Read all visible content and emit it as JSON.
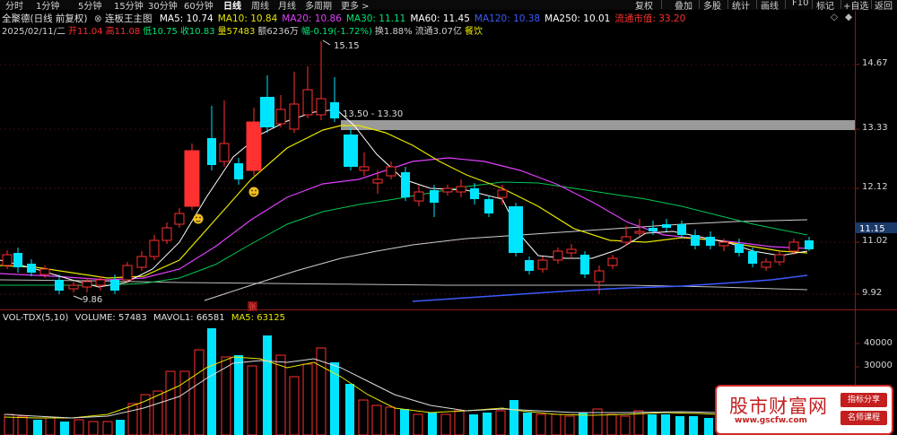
{
  "toolbar": {
    "period_tabs": [
      "分时",
      "1分钟",
      "5分钟",
      "15分钟",
      "30分钟",
      "60分钟",
      "日线",
      "周线",
      "月线",
      "多周期",
      "更多 >"
    ],
    "active_tab": "日线",
    "right_tabs": [
      "复权",
      "叠加",
      "多股",
      "统计",
      "画线",
      "F10",
      "标记",
      "+自选",
      "返回"
    ]
  },
  "title": {
    "stock": "全聚德(日线 前复权)",
    "indicator": "连板王主图",
    "ma_values": [
      {
        "label": "MA5: 10.74",
        "color": "#ffffff"
      },
      {
        "label": "MA10: 10.84",
        "color": "#e6e600"
      },
      {
        "label": "MA20: 10.86",
        "color": "#e040fb"
      },
      {
        "label": "MA30: 11.11",
        "color": "#00e676"
      },
      {
        "label": "MA60: 11.45",
        "color": "#ffffff"
      },
      {
        "label": "MA120: 10.38",
        "color": "#3d5afe"
      },
      {
        "label": "MA250: 10.01",
        "color": "#ffffff"
      },
      {
        "label": "流通市值: 33.20",
        "color": "#ff3030"
      }
    ],
    "close_icon": "diamond-icon"
  },
  "info": [
    {
      "text": "2025/02/11/二",
      "color": "#cfcfcf"
    },
    {
      "text": "开11.04",
      "color": "#ff3030"
    },
    {
      "text": "高11.08",
      "color": "#ff3030"
    },
    {
      "text": "低10.75",
      "color": "#00e676"
    },
    {
      "text": "收10.83",
      "color": "#00e676"
    },
    {
      "text": "量57483",
      "color": "#e6e600"
    },
    {
      "text": "额6236万",
      "color": "#cfcfcf"
    },
    {
      "text": "幅-0.19(-1.72%)",
      "color": "#00e676"
    },
    {
      "text": "换1.88%",
      "color": "#cfcfcf"
    },
    {
      "text": "流通3.07亿",
      "color": "#cfcfcf"
    },
    {
      "text": "餐饮",
      "color": "#e6e600"
    }
  ],
  "price_axis": {
    "ticks": [
      "14.67",
      "13.33",
      "12.12",
      "11.02",
      "9.92"
    ],
    "current_price": "11.15"
  },
  "annotations": {
    "high_label": "15.15",
    "low_label": "9.86",
    "band_label": "13.50 - 13.30",
    "limit_marker": "张"
  },
  "volume": {
    "title": "VOL-TDX(5,10)",
    "volume_label": "VOLUME: 57483",
    "mavol_label": "MAVOL1: 66581",
    "ma5_label": "MA5: 63125",
    "ticks": [
      "40000",
      "30000"
    ]
  },
  "ad": {
    "brand": "股市财富网",
    "url": "www.gscfw.com",
    "button1": "指标分享",
    "button2": "名师课程"
  },
  "colors": {
    "up": "#ff3030",
    "down": "#00e5ff",
    "background": "#000000"
  }
}
